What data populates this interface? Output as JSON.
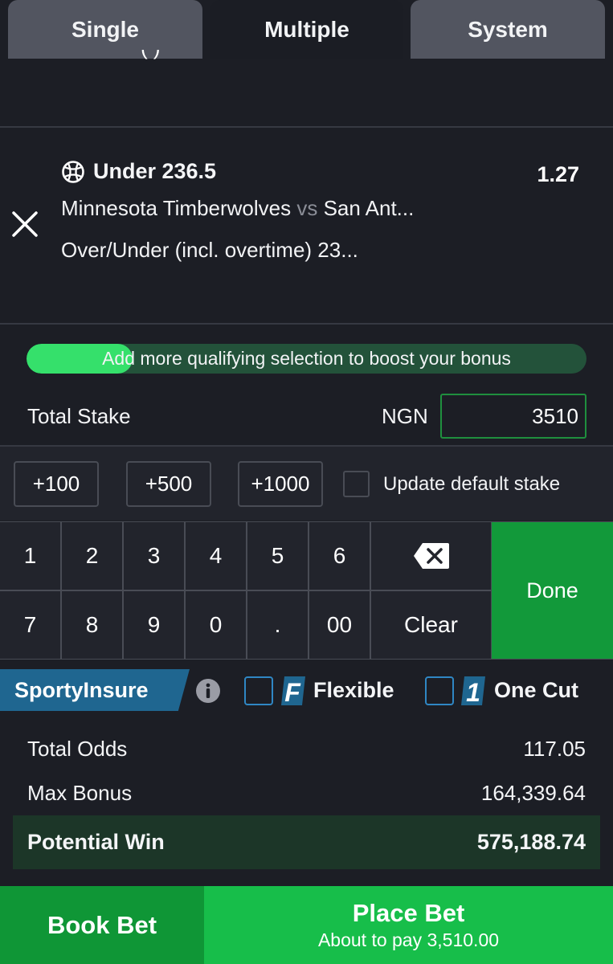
{
  "tabs": [
    {
      "label": "Single",
      "active": false
    },
    {
      "label": "Multiple",
      "active": true
    },
    {
      "label": "System",
      "active": false
    }
  ],
  "cutoff_line": "(               )",
  "selection": {
    "sport_icon": "basketball-icon",
    "pick": "Under 236.5",
    "odds": "1.27",
    "home_team": "Minnesota Timberwolves",
    "vs": "vs",
    "away_team": "San Ant...",
    "market": "Over/Under (incl. overtime) 23...",
    "remove_icon": "close-icon"
  },
  "bonus_progress": {
    "text": "Add more qualifying selection to boost your bonus",
    "fill_fraction": 0.19,
    "colors": {
      "fill": "#35e06b",
      "track": "#23523a"
    }
  },
  "stake": {
    "label": "Total Stake",
    "currency": "NGN",
    "value": "3510"
  },
  "quick_stakes": [
    "+100",
    "+500",
    "+1000"
  ],
  "update_default_stake": {
    "label": "Update default stake",
    "checked": false
  },
  "keypad": {
    "row1": [
      "1",
      "2",
      "3",
      "4",
      "5",
      "6"
    ],
    "row2": [
      "7",
      "8",
      "9",
      "0",
      ".",
      "00"
    ],
    "backspace_icon": "backspace-icon",
    "clear": "Clear",
    "done": "Done"
  },
  "insure": {
    "brand": "SportyInsure",
    "info_icon": "info-icon",
    "options": [
      {
        "badge": "F",
        "label": "Flexible",
        "checked": false
      },
      {
        "badge": "1",
        "label": "One Cut",
        "checked": false
      }
    ]
  },
  "summary": {
    "total_odds_label": "Total Odds",
    "total_odds": "117.05",
    "max_bonus_label": "Max Bonus",
    "max_bonus": "164,339.64",
    "potential_win_label": "Potential Win",
    "potential_win": "575,188.74"
  },
  "footer": {
    "book_bet": "Book Bet",
    "place_bet": "Place Bet",
    "about_to_pay": "About to pay 3,510.00"
  },
  "colors": {
    "background": "#1c1e25",
    "accent_green": "#17be4a",
    "dark_green": "#0f9636",
    "insure_blue": "#1f6690"
  }
}
